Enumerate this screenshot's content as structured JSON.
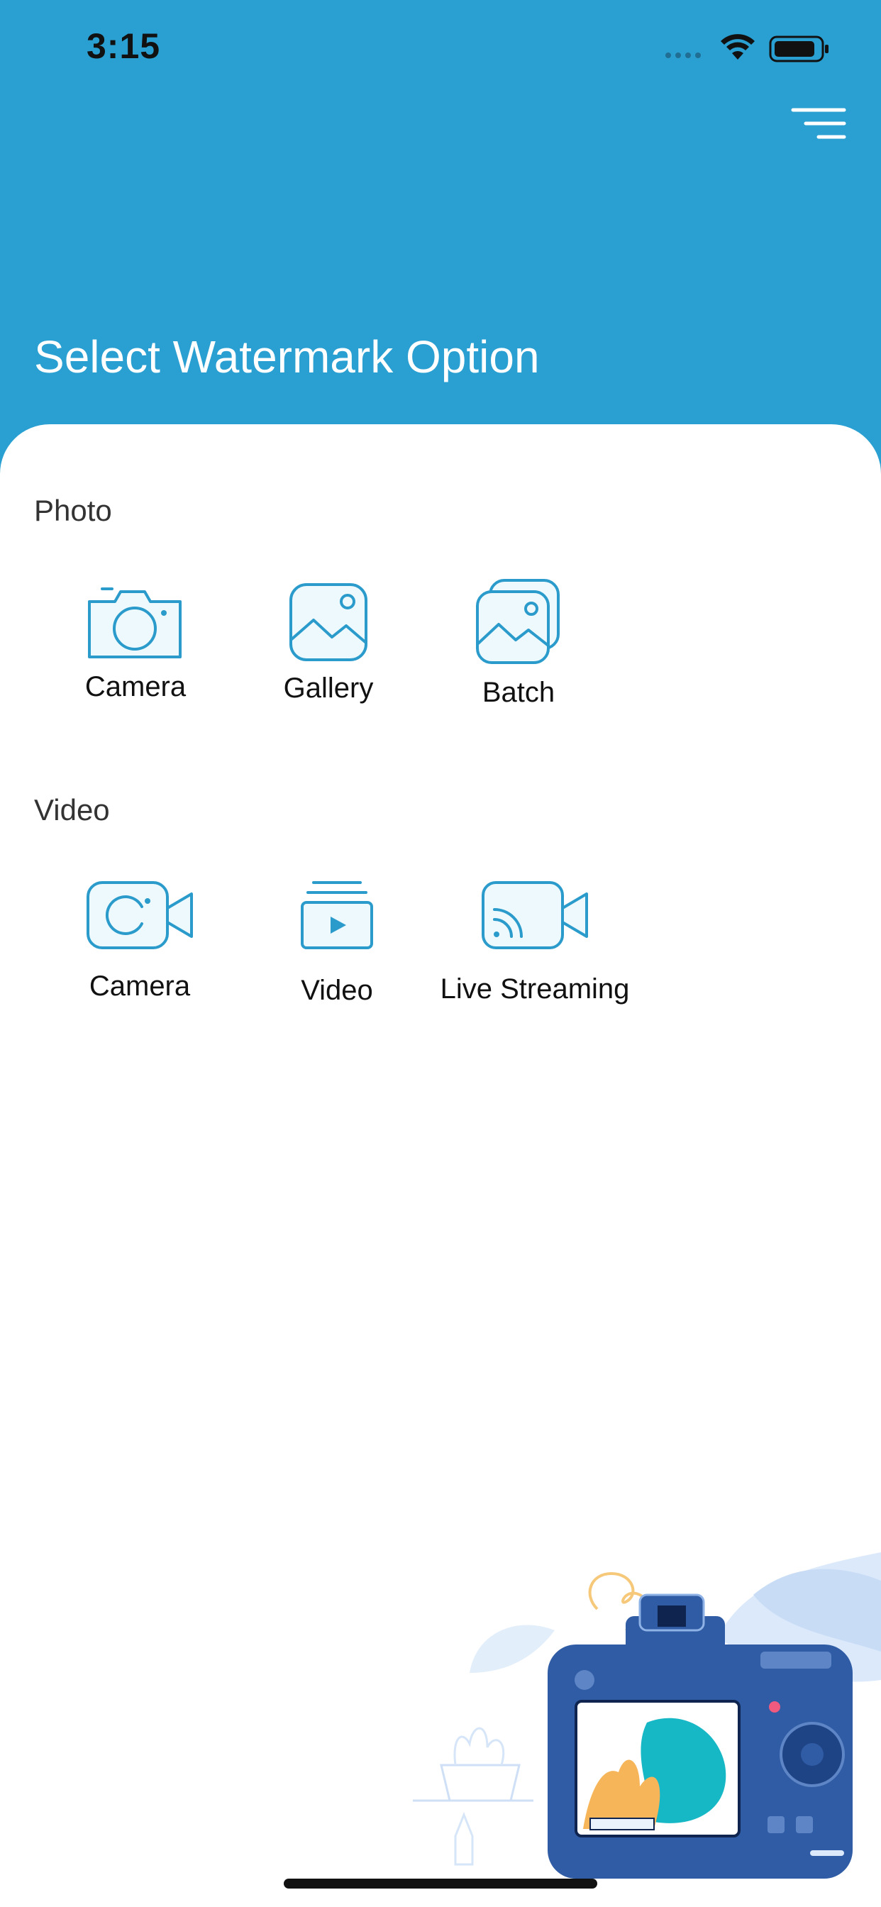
{
  "status_bar": {
    "time": "3:15"
  },
  "header": {
    "title": "Select Watermark Option",
    "menu_icon": "menu-icon"
  },
  "sections": [
    {
      "label": "Photo",
      "options": [
        {
          "label": "Camera",
          "icon": "photo-camera-icon"
        },
        {
          "label": "Gallery",
          "icon": "gallery-icon"
        },
        {
          "label": "Batch",
          "icon": "batch-icon"
        }
      ]
    },
    {
      "label": "Video",
      "options": [
        {
          "label": "Camera",
          "icon": "video-camera-icon"
        },
        {
          "label": "Video",
          "icon": "video-icon"
        },
        {
          "label": "Live Streaming",
          "icon": "live-streaming-icon"
        }
      ]
    }
  ],
  "colors": {
    "header_bg": "#2aa0d2",
    "icon_stroke": "#2a9bcb",
    "icon_fill": "#eef9fd"
  }
}
